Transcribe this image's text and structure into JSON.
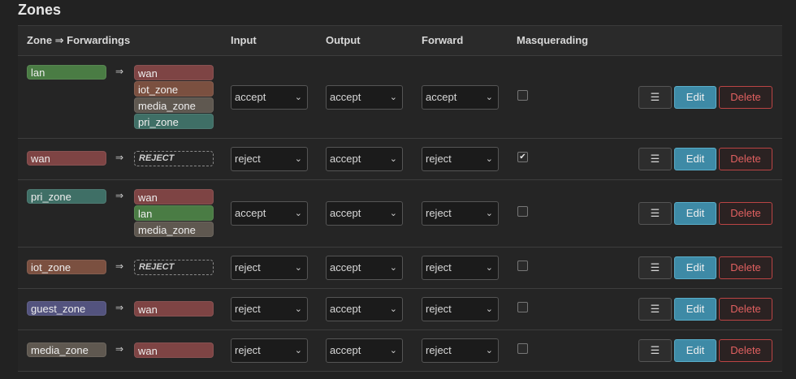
{
  "title": "Zones",
  "headers": {
    "zone_forwardings": "Zone ⇒ Forwardings",
    "input": "Input",
    "output": "Output",
    "forward": "Forward",
    "masquerading": "Masquerading"
  },
  "arrow_glyph": "⇒",
  "chevron_glyph": "⌄",
  "check_glyph": "✔",
  "buttons": {
    "menu": "☰",
    "edit": "Edit",
    "delete": "Delete"
  },
  "colors": {
    "lan": "#4a7c44",
    "wan": "#7e4444",
    "iot_zone": "#7b5040",
    "media_zone": "#5f5850",
    "pri_zone": "#3f6f66",
    "guest_zone": "#53537e"
  },
  "rows": [
    {
      "zone": "lan",
      "forwardings": [
        "wan",
        "iot_zone",
        "media_zone",
        "pri_zone"
      ],
      "reject": false,
      "input": "accept",
      "output": "accept",
      "forward": "accept",
      "masquerading": false
    },
    {
      "zone": "wan",
      "forwardings": [],
      "reject": true,
      "reject_label": "REJECT",
      "input": "reject",
      "output": "accept",
      "forward": "reject",
      "masquerading": true
    },
    {
      "zone": "pri_zone",
      "forwardings": [
        "wan",
        "lan",
        "media_zone"
      ],
      "reject": false,
      "input": "accept",
      "output": "accept",
      "forward": "reject",
      "masquerading": false
    },
    {
      "zone": "iot_zone",
      "forwardings": [],
      "reject": true,
      "reject_label": "REJECT",
      "input": "reject",
      "output": "accept",
      "forward": "reject",
      "masquerading": false
    },
    {
      "zone": "guest_zone",
      "forwardings": [
        "wan"
      ],
      "reject": false,
      "input": "reject",
      "output": "accept",
      "forward": "reject",
      "masquerading": false
    },
    {
      "zone": "media_zone",
      "forwardings": [
        "wan"
      ],
      "reject": false,
      "input": "reject",
      "output": "accept",
      "forward": "reject",
      "masquerading": false
    }
  ]
}
